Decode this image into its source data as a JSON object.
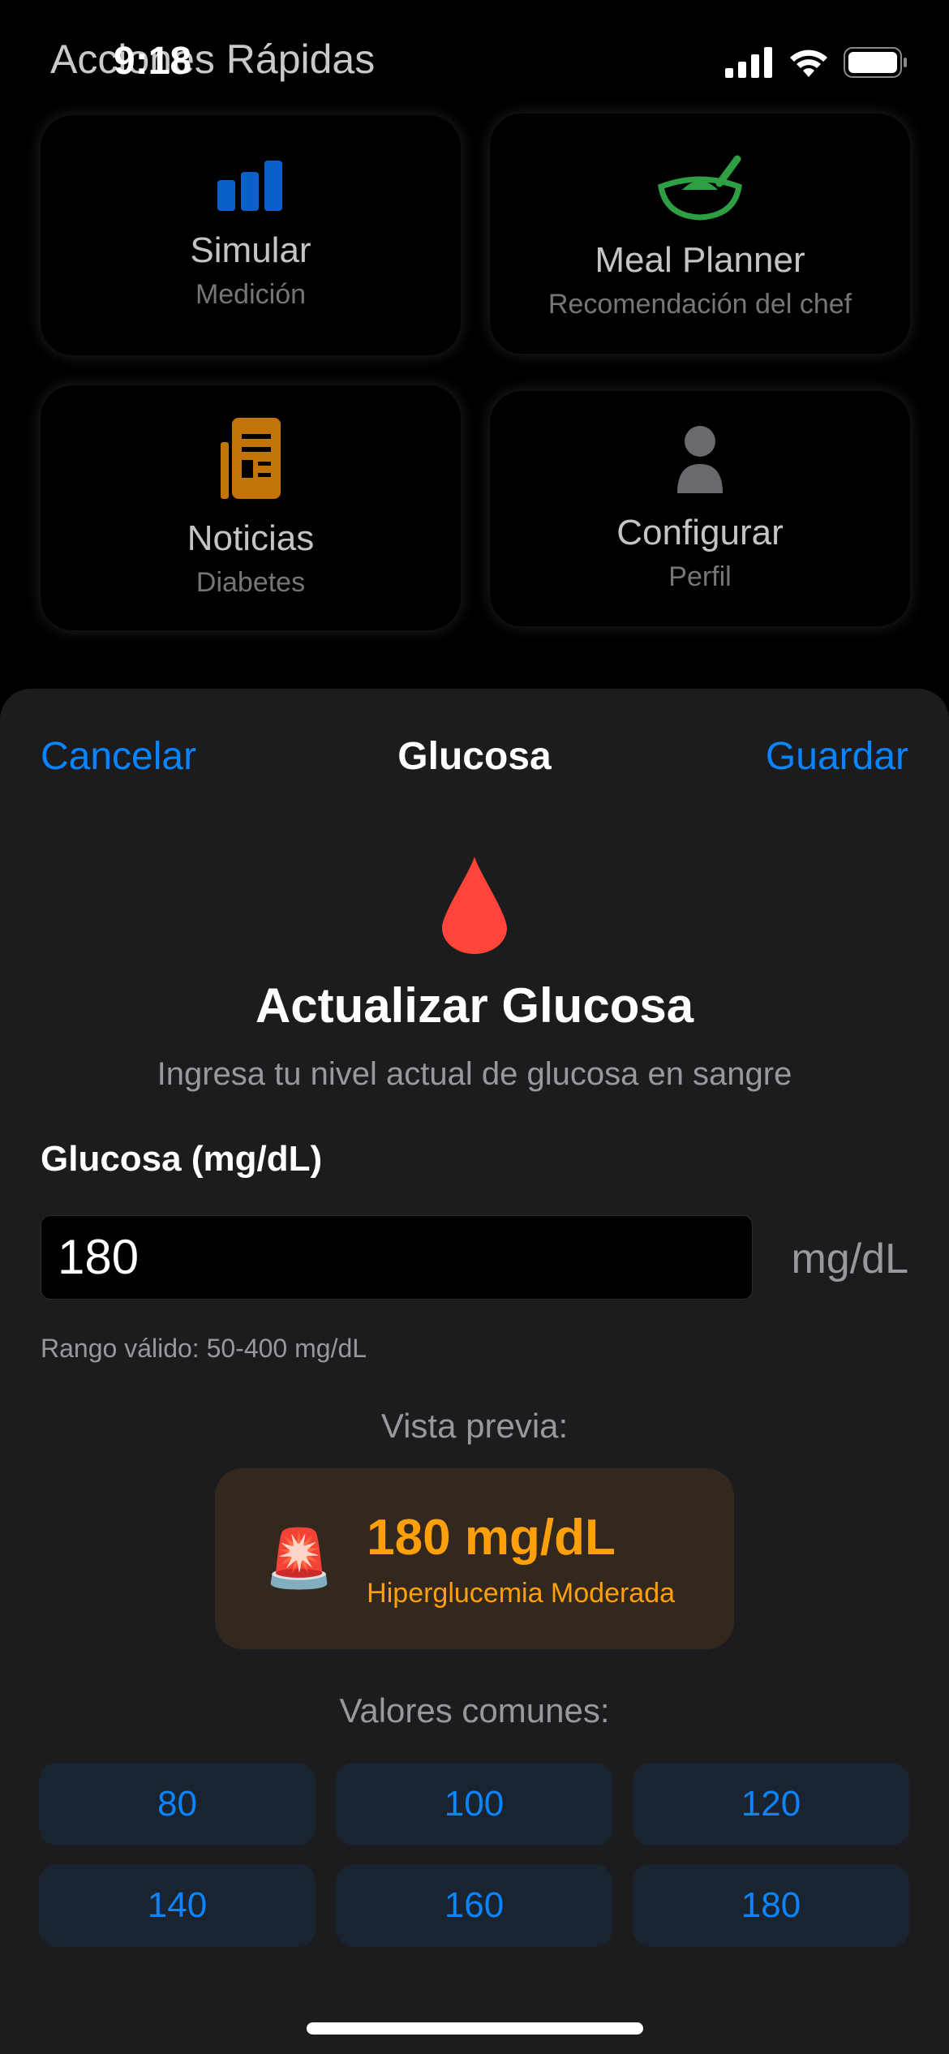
{
  "status_bar": {
    "time": "9:18"
  },
  "background": {
    "section_title": "Acciones Rápidas",
    "cards": [
      {
        "title": "Simular",
        "subtitle": "Medición",
        "icon": "chart-bar-icon",
        "color": "#0a60c8"
      },
      {
        "title": "Meal Planner",
        "subtitle": "Recomendación del chef",
        "icon": "bowl-icon",
        "color": "#2ea043"
      },
      {
        "title": "Noticias",
        "subtitle": "Diabetes",
        "icon": "newspaper-icon",
        "color": "#c27408"
      },
      {
        "title": "Configurar",
        "subtitle": "Perfil",
        "icon": "person-icon",
        "color": "#6a6a6e"
      }
    ]
  },
  "sheet": {
    "cancel": "Cancelar",
    "title": "Glucosa",
    "save": "Guardar",
    "heading": "Actualizar Glucosa",
    "subheading": "Ingresa tu nivel actual de glucosa en sangre",
    "field_label": "Glucosa (mg/dL)",
    "field_value": "180",
    "unit": "mg/dL",
    "range_hint": "Rango válido: 50-400 mg/dL",
    "preview_label": "Vista previa:",
    "preview": {
      "emoji": "🚨",
      "value": "180 mg/dL",
      "status": "Hiperglucemia Moderada",
      "color": "#ff9f0a"
    },
    "common_label": "Valores comunes:",
    "common_values": [
      "80",
      "100",
      "120",
      "140",
      "160",
      "180"
    ]
  }
}
